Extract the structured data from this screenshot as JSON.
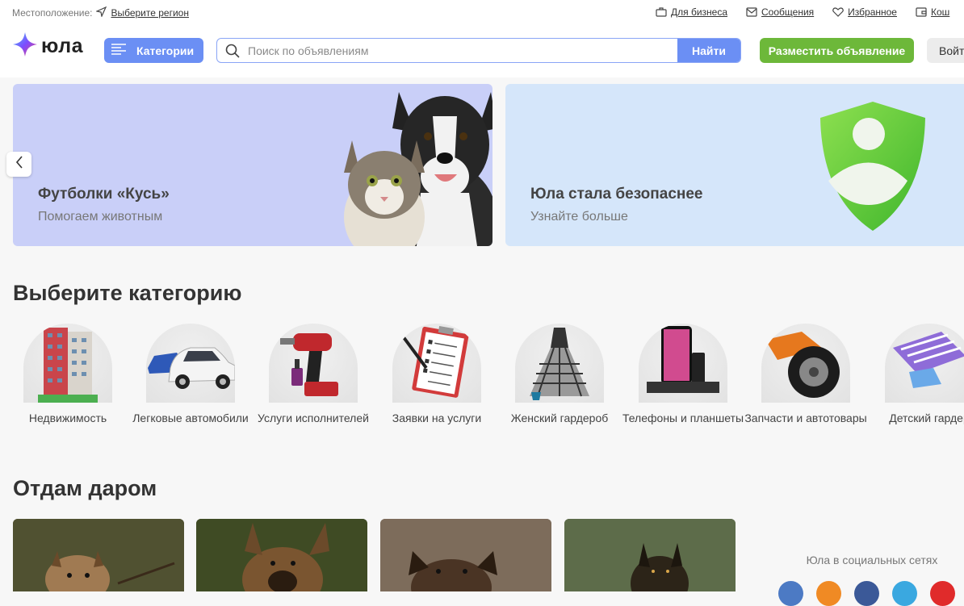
{
  "topbar": {
    "location_label": "Местоположение:",
    "region_link": "Выберите регион",
    "links": [
      {
        "label": "Для бизнеса",
        "icon": "briefcase-icon"
      },
      {
        "label": "Сообщения",
        "icon": "mail-icon"
      },
      {
        "label": "Избранное",
        "icon": "heart-icon"
      },
      {
        "label": "Кош",
        "icon": "wallet-icon"
      }
    ]
  },
  "header": {
    "logo_text": "юла",
    "categories_button": "Категории",
    "search_placeholder": "Поиск по объявлениям",
    "search_button": "Найти",
    "post_button": "Разместить объявление",
    "login_button": "Войт"
  },
  "banners": [
    {
      "title": "Футболки «Кусь»",
      "subtitle": "Помогаем животным"
    },
    {
      "title": "Юла стала безопаснее",
      "subtitle": "Узнайте больше"
    }
  ],
  "categories_section": {
    "title": "Выберите категорию",
    "items": [
      {
        "label": "Недвижимость"
      },
      {
        "label": "Легковые автомобили"
      },
      {
        "label": "Услуги исполнителей"
      },
      {
        "label": "Заявки на услуги"
      },
      {
        "label": "Женский гардероб"
      },
      {
        "label": "Телефоны и планшеты"
      },
      {
        "label": "Запчасти и автотовары"
      },
      {
        "label": "Детский гардер"
      }
    ]
  },
  "free_section": {
    "title": "Отдам даром"
  },
  "social": {
    "title": "Юла в социальных сетях"
  },
  "colors": {
    "accent_blue": "#6b8ff4",
    "accent_green": "#6db83a"
  }
}
